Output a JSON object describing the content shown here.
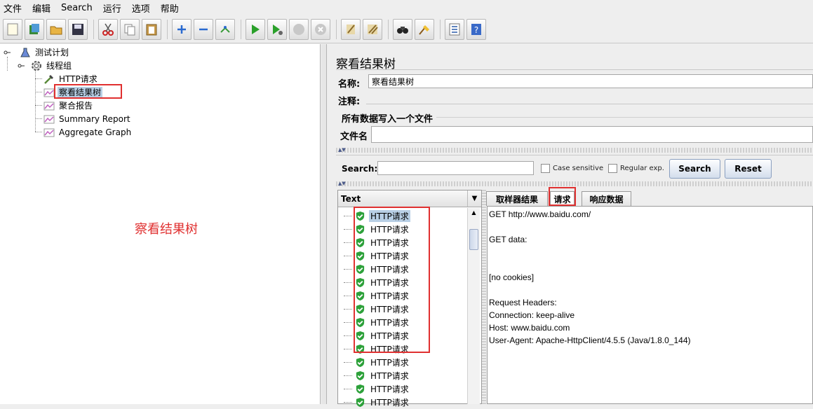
{
  "menu": [
    "文件",
    "编辑",
    "Search",
    "运行",
    "选项",
    "帮助"
  ],
  "toolbar": {
    "icons": [
      "new-icon",
      "templates-icon",
      "open-icon",
      "save-icon",
      "cut-icon",
      "copy-icon",
      "paste-icon",
      "expand-icon",
      "collapse-icon",
      "toggle-icon",
      "start-icon",
      "start-no-pause-icon",
      "stop-icon",
      "shutdown-icon",
      "clear-icon",
      "clear-all-icon",
      "search-icon",
      "reset-search-icon",
      "function-helper-icon",
      "help-icon"
    ]
  },
  "tree": {
    "items": [
      {
        "label": "测试计划"
      },
      {
        "label": "线程组"
      },
      {
        "label": "HTTP请求"
      },
      {
        "label": "察看结果树"
      },
      {
        "label": "聚合报告"
      },
      {
        "label": "Summary Report"
      },
      {
        "label": "Aggregate Graph"
      }
    ]
  },
  "annotation": {
    "text": "察看结果树",
    "color": "#e03030"
  },
  "panel": {
    "title": "察看结果树",
    "name_label": "名称:",
    "name_value": "察看结果树",
    "comment_label": "注释:",
    "file_group_title": "所有数据写入一个文件",
    "file_label": "文件名"
  },
  "search": {
    "label": "Search:",
    "case_sensitive": "Case sensitive",
    "regular_exp": "Regular exp.",
    "search_button": "Search",
    "reset_button": "Reset"
  },
  "results": {
    "header": "Text",
    "items": [
      "HTTP请求",
      "HTTP请求",
      "HTTP请求",
      "HTTP请求",
      "HTTP请求",
      "HTTP请求",
      "HTTP请求",
      "HTTP请求",
      "HTTP请求",
      "HTTP请求",
      "HTTP请求",
      "HTTP请求",
      "HTTP请求",
      "HTTP请求",
      "HTTP请求"
    ]
  },
  "tabs": [
    {
      "label": "取样器结果"
    },
    {
      "label": "请求"
    },
    {
      "label": "响应数据"
    }
  ],
  "request_content": [
    "GET http://www.baidu.com/",
    "",
    "GET data:",
    "",
    "",
    "[no cookies]",
    "",
    "Request Headers:",
    "Connection: keep-alive",
    "Host: www.baidu.com",
    "User-Agent: Apache-HttpClient/4.5.5 (Java/1.8.0_144)"
  ],
  "colors": {
    "selection": "#b8cfe5",
    "annotation": "#e03030",
    "success": "#2da13a"
  }
}
